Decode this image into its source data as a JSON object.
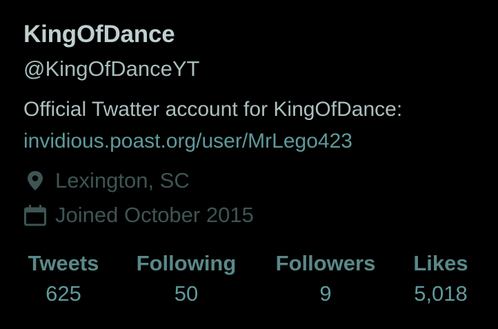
{
  "profile": {
    "display_name": "KingOfDance",
    "handle": "@KingOfDanceYT",
    "bio_text": "Official Twatter account for KingOfDance:",
    "bio_link": "invidious.poast.org/user/MrLego423",
    "location": "Lexington, SC",
    "joined": "Joined October 2015"
  },
  "stats": [
    {
      "label": "Tweets",
      "value": "625"
    },
    {
      "label": "Following",
      "value": "50"
    },
    {
      "label": "Followers",
      "value": "9"
    },
    {
      "label": "Likes",
      "value": "5,018"
    }
  ],
  "icons": {
    "location": "map-pin-icon",
    "joined": "calendar-icon"
  },
  "colors": {
    "background": "#000000",
    "name": "#bfcfcf",
    "link": "#5f9a9c",
    "muted": "#3f5454",
    "stat_label": "#5a8888"
  }
}
